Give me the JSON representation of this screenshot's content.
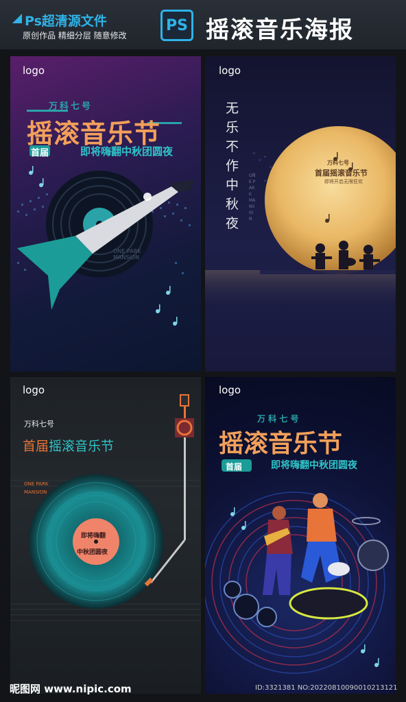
{
  "header": {
    "brand_title": "Ps超清源文件",
    "subtitle": "原创作品 精细分层 随意修改",
    "badge": "PS",
    "poster_title": "摇滚音乐海报"
  },
  "poster1": {
    "logo": "logo",
    "org": "万科七号",
    "main_title": "摇滚音乐节",
    "first_tag": "首届",
    "tagline": "即将嗨翻中秋团圆夜",
    "venue": "ONE PARK MANSION"
  },
  "poster2": {
    "logo": "logo",
    "vertical_text": "无乐不作中秋夜",
    "org": "万科七号",
    "main_title": "首届摇滚音乐节",
    "sub": "即将开启无限狂欢",
    "venue": "ONE PARK MANSION"
  },
  "poster3": {
    "logo": "logo",
    "org": "万科七号",
    "title_first": "首届",
    "title_rest": "摇滚音乐节",
    "venue": "ONE PARK MANSION",
    "label_line1": "即将嗨翻",
    "label_line2": "中秋团圆夜"
  },
  "poster4": {
    "logo": "logo",
    "org": "万 科 七 号",
    "main_title": "摇滚音乐节",
    "first_tag": "首届",
    "tagline": "即将嗨翻中秋团圆夜"
  },
  "footer": {
    "site": "昵图网 www.nipic.com",
    "id_text": "ID:3321381 NO:20220810090010213121"
  },
  "colors": {
    "accent_blue": "#2fb3e8",
    "teal": "#2a9c98",
    "orange": "#e8743a",
    "moon": "#f3c77a"
  }
}
